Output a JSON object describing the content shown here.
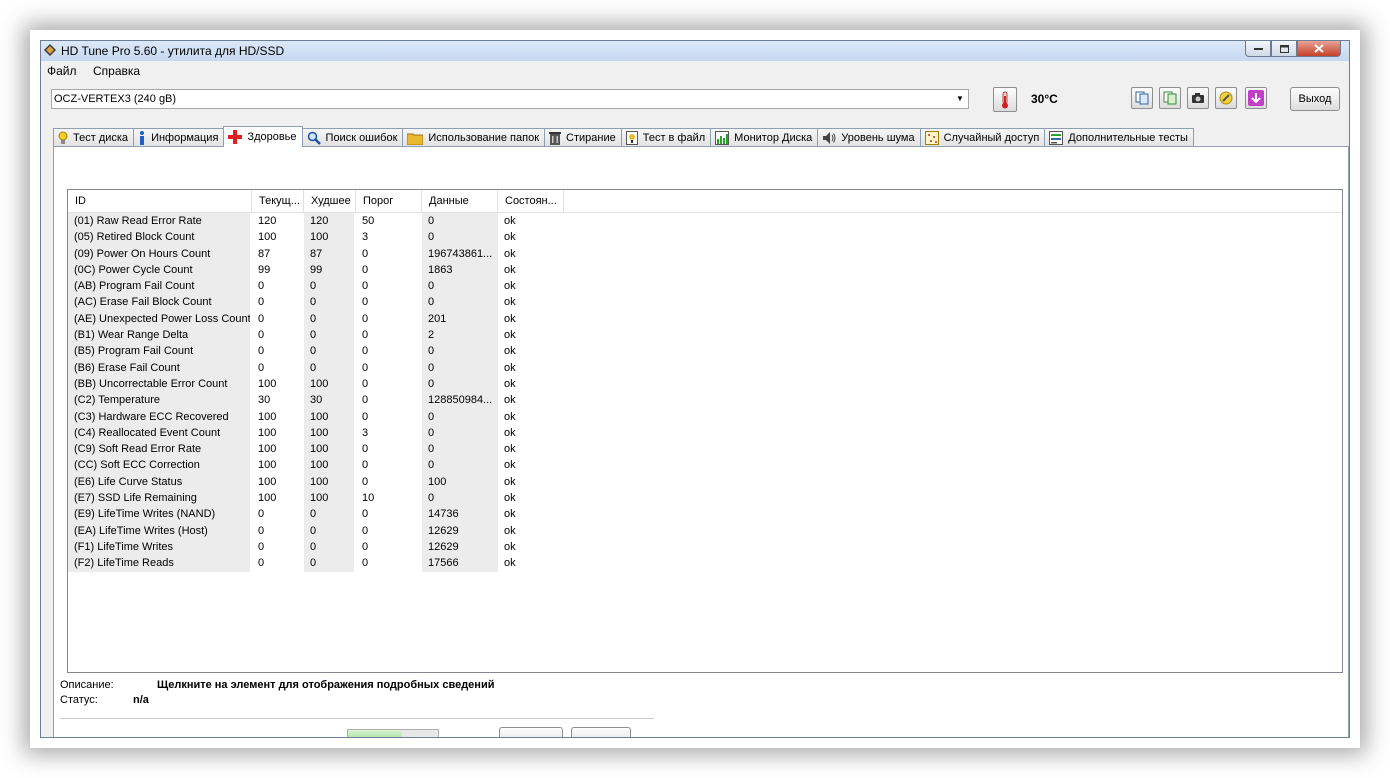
{
  "window": {
    "title": "HD Tune Pro 5.60 - утилита для HD/SSD"
  },
  "menu": {
    "file": "Файл",
    "help": "Справка"
  },
  "toolbar": {
    "drive": "OCZ-VERTEX3 (240 gB)",
    "temperature": "30°C",
    "exit_label": "Выход"
  },
  "tabs": [
    {
      "label": "Тест диска",
      "icon": "lightbulb-icon"
    },
    {
      "label": "Информация",
      "icon": "info-icon"
    },
    {
      "label": "Здоровье",
      "icon": "red-cross-icon",
      "active": true
    },
    {
      "label": "Поиск ошибок",
      "icon": "magnifier-icon"
    },
    {
      "label": "Использование папок",
      "icon": "folder-icon"
    },
    {
      "label": "Стирание",
      "icon": "trash-icon"
    },
    {
      "label": "Тест в файл",
      "icon": "file-test-icon"
    },
    {
      "label": "Монитор Диска",
      "icon": "bar-chart-icon"
    },
    {
      "label": "Уровень шума",
      "icon": "speaker-icon"
    },
    {
      "label": "Случайный доступ",
      "icon": "random-access-icon"
    },
    {
      "label": "Дополнительные  тесты",
      "icon": "extra-tests-icon"
    }
  ],
  "table": {
    "columns": [
      "ID",
      "Текущ...",
      "Худшее",
      "Порог",
      "Данные",
      "Состоян..."
    ],
    "rows": [
      [
        "(01) Raw Read Error Rate",
        "120",
        "120",
        "50",
        "0",
        "ok"
      ],
      [
        "(05) Retired Block Count",
        "100",
        "100",
        "3",
        "0",
        "ok"
      ],
      [
        "(09) Power On Hours Count",
        "87",
        "87",
        "0",
        "196743861...",
        "ok"
      ],
      [
        "(0C) Power Cycle Count",
        "99",
        "99",
        "0",
        "1863",
        "ok"
      ],
      [
        "(AB) Program Fail Count",
        "0",
        "0",
        "0",
        "0",
        "ok"
      ],
      [
        "(AC) Erase Fail Block Count",
        "0",
        "0",
        "0",
        "0",
        "ok"
      ],
      [
        "(AE) Unexpected Power Loss Count",
        "0",
        "0",
        "0",
        "201",
        "ok"
      ],
      [
        "(B1) Wear Range Delta",
        "0",
        "0",
        "0",
        "2",
        "ok"
      ],
      [
        "(B5) Program Fail Count",
        "0",
        "0",
        "0",
        "0",
        "ok"
      ],
      [
        "(B6) Erase Fail Count",
        "0",
        "0",
        "0",
        "0",
        "ok"
      ],
      [
        "(BB) Uncorrectable Error Count",
        "100",
        "100",
        "0",
        "0",
        "ok"
      ],
      [
        "(C2) Temperature",
        "30",
        "30",
        "0",
        "128850984...",
        "ok"
      ],
      [
        "(C3) Hardware ECC Recovered",
        "100",
        "100",
        "0",
        "0",
        "ok"
      ],
      [
        "(C4) Reallocated Event Count",
        "100",
        "100",
        "3",
        "0",
        "ok"
      ],
      [
        "(C9) Soft Read Error Rate",
        "100",
        "100",
        "0",
        "0",
        "ok"
      ],
      [
        "(CC) Soft ECC Correction",
        "100",
        "100",
        "0",
        "0",
        "ok"
      ],
      [
        "(E6) Life Curve Status",
        "100",
        "100",
        "0",
        "100",
        "ok"
      ],
      [
        "(E7) SSD Life Remaining",
        "100",
        "100",
        "10",
        "0",
        "ok"
      ],
      [
        "(E9) LifeTime Writes (NAND)",
        "0",
        "0",
        "0",
        "14736",
        "ok"
      ],
      [
        "(EA) LifeTime Writes (Host)",
        "0",
        "0",
        "0",
        "12629",
        "ok"
      ],
      [
        "(F1) LifeTime Writes",
        "0",
        "0",
        "0",
        "12629",
        "ok"
      ],
      [
        "(F2) LifeTime Reads",
        "0",
        "0",
        "0",
        "17566",
        "ok"
      ]
    ]
  },
  "description": {
    "label": "Описание:",
    "value": "Щелкните на элемент для отображения подробных сведений"
  },
  "status": {
    "label": "Статус:",
    "value": "n/a"
  },
  "progress": {
    "fraction": 0.6
  },
  "colors": {
    "title_bar": "#c6d8ef",
    "close_button": "#c4412a",
    "panel_bg": "#ffffff",
    "shaded_column": "#ececec"
  }
}
